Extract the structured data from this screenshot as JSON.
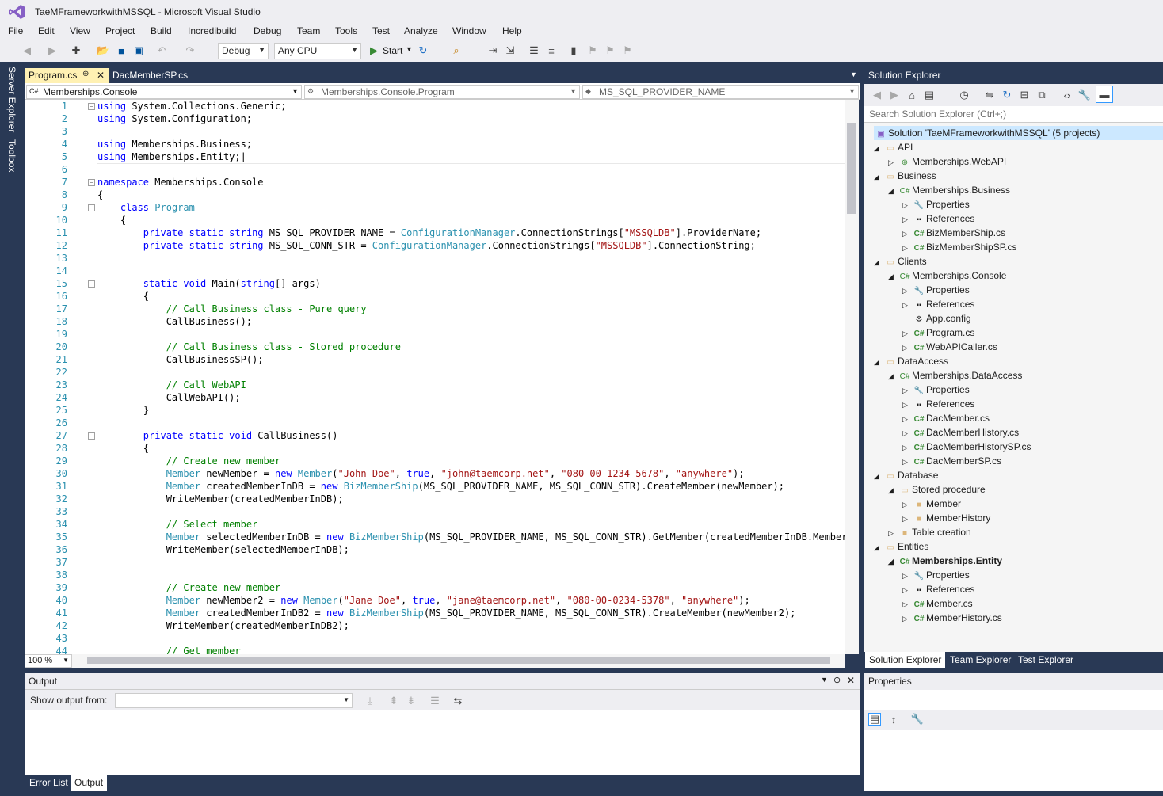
{
  "window": {
    "title": "TaeMFrameworkwithMSSQL - Microsoft Visual Studio"
  },
  "menu": [
    "File",
    "Edit",
    "View",
    "Project",
    "Build",
    "Incredibuild",
    "Debug",
    "Team",
    "Tools",
    "Test",
    "Analyze",
    "Window",
    "Help"
  ],
  "toolbar": {
    "config": "Debug",
    "platform": "Any CPU",
    "start": "Start"
  },
  "side_tabs": {
    "server_explorer": "Server Explorer",
    "toolbox": "Toolbox"
  },
  "tabs": [
    {
      "label": "Program.cs",
      "pinned": "⊕"
    },
    {
      "label": "DacMemberSP.cs"
    }
  ],
  "nav": {
    "project": "Memberships.Console",
    "class": "Memberships.Console.Program",
    "member": "MS_SQL_PROVIDER_NAME"
  },
  "code": {
    "line_numbers": [
      "1",
      "2",
      "3",
      "4",
      "5",
      "6",
      "7",
      "8",
      "9",
      "10",
      "11",
      "12",
      "13",
      "14",
      "15",
      "16",
      "17",
      "18",
      "19",
      "20",
      "21",
      "22",
      "23",
      "24",
      "25",
      "26",
      "27",
      "28",
      "29",
      "30",
      "31",
      "32",
      "33",
      "34",
      "35",
      "36",
      "37",
      "38",
      "39",
      "40",
      "41",
      "42",
      "43",
      "44"
    ]
  },
  "zoom": "100 %",
  "output": {
    "title": "Output",
    "show_from": "Show output from:"
  },
  "bottom_tabs": [
    "Error List",
    "Output"
  ],
  "solution_explorer": {
    "title": "Solution Explorer",
    "search_placeholder": "Search Solution Explorer (Ctrl+;)",
    "solution": "Solution 'TaeMFrameworkwithMSSQL' (5 projects)",
    "nodes": [
      {
        "label": "API"
      },
      {
        "label": "Memberships.WebAPI"
      },
      {
        "label": "Business"
      },
      {
        "label": "Memberships.Business"
      },
      {
        "label": "Properties"
      },
      {
        "label": "References"
      },
      {
        "label": "BizMemberShip.cs"
      },
      {
        "label": "BizMemberShipSP.cs"
      },
      {
        "label": "Clients"
      },
      {
        "label": "Memberships.Console"
      },
      {
        "label": "Properties"
      },
      {
        "label": "References"
      },
      {
        "label": "App.config"
      },
      {
        "label": "Program.cs"
      },
      {
        "label": "WebAPICaller.cs"
      },
      {
        "label": "DataAccess"
      },
      {
        "label": "Memberships.DataAccess"
      },
      {
        "label": "Properties"
      },
      {
        "label": "References"
      },
      {
        "label": "DacMember.cs"
      },
      {
        "label": "DacMemberHistory.cs"
      },
      {
        "label": "DacMemberHistorySP.cs"
      },
      {
        "label": "DacMemberSP.cs"
      },
      {
        "label": "Database"
      },
      {
        "label": "Stored procedure"
      },
      {
        "label": "Member"
      },
      {
        "label": "MemberHistory"
      },
      {
        "label": "Table creation"
      },
      {
        "label": "Entities"
      },
      {
        "label": "Memberships.Entity"
      },
      {
        "label": "Properties"
      },
      {
        "label": "References"
      },
      {
        "label": "Member.cs"
      },
      {
        "label": "MemberHistory.cs"
      }
    ],
    "bottom_tabs": [
      "Solution Explorer",
      "Team Explorer",
      "Test Explorer"
    ]
  },
  "properties": {
    "title": "Properties"
  }
}
